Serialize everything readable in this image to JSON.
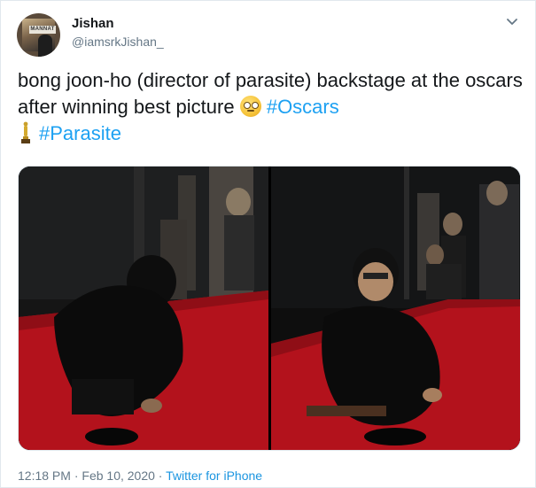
{
  "user": {
    "name": "Jishan",
    "handle": "@iamsrkJishan_",
    "avatar_sign_text": "MANNAT"
  },
  "tweet": {
    "text_part1": "bong joon-ho (director of parasite) backstage at the oscars after winning best picture",
    "emoji": "face-with-rolling-eyes",
    "hashtag1": "#Oscars",
    "trophy_icon": "oscar-trophy-icon",
    "hashtag2": "#Parasite"
  },
  "media": {
    "photo_count": 2
  },
  "meta": {
    "time": "12:18 PM",
    "separator": "·",
    "date": "Feb 10, 2020",
    "source": "Twitter for iPhone"
  },
  "colors": {
    "link": "#1da1f2",
    "secondary_text": "#657786",
    "carpet_red": "#b3121c"
  }
}
